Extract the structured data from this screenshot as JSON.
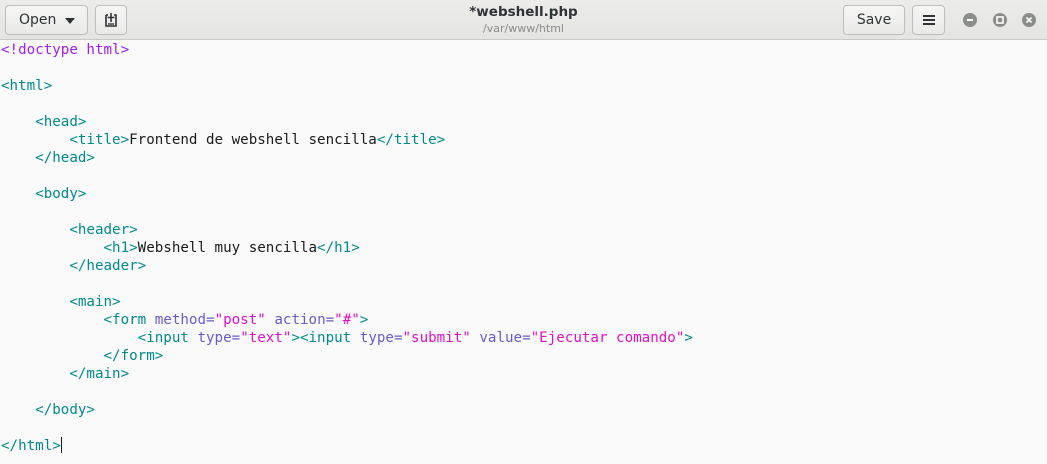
{
  "header": {
    "open_label": "Open",
    "save_label": "Save",
    "title": "*webshell.php",
    "subtitle": "/var/www/html"
  },
  "icons": {
    "open_caret": "chevron-down-icon",
    "new_tab": "new-document-icon",
    "menu": "hamburger-menu-icon",
    "minimize": "minimize-icon",
    "maximize": "maximize-icon",
    "close": "close-icon"
  },
  "colors": {
    "tag": "#008a8c",
    "attribute": "#6a5acd",
    "string": "#e012c8",
    "doctype": "#a020f0"
  },
  "code": {
    "l1": "<!doctype html>",
    "l3": "<html>",
    "l5": "<head>",
    "l6_open": "<title>",
    "l6_text": "Frontend de webshell sencilla",
    "l6_close": "</title>",
    "l7": "</head>",
    "l9": "<body>",
    "l11": "<header>",
    "l12_open": "<h1>",
    "l12_text": "Webshell muy sencilla",
    "l12_close": "</h1>",
    "l13": "</header>",
    "l15": "<main>",
    "l16_a": "<form",
    "l16_attr1": "method=",
    "l16_val1": "\"post\"",
    "l16_attr2": "action=",
    "l16_val2": "\"#\"",
    "l16_end": ">",
    "l17_a": "<input",
    "l17_attr1": "type=",
    "l17_val1": "\"text\"",
    "l17_b": "><input",
    "l17_attr2": "type=",
    "l17_val2": "\"submit\"",
    "l17_attr3": "value=",
    "l17_val3": "\"Ejecutar comando\"",
    "l17_end": ">",
    "l18": "</form>",
    "l19": "</main>",
    "l21": "</body>",
    "l23": "</html>"
  }
}
